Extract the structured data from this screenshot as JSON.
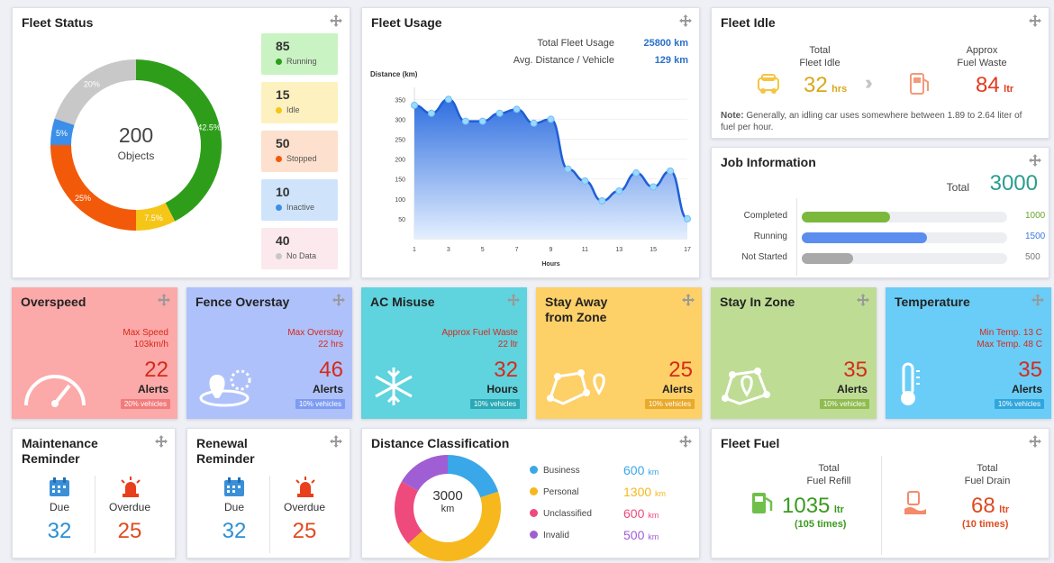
{
  "fleet_status": {
    "title": "Fleet Status",
    "total": "200",
    "total_label": "Objects",
    "segments": [
      {
        "label": "Running",
        "count": "85",
        "percent": 42.5,
        "percent_label": "42.5%",
        "color": "#2e9e1a"
      },
      {
        "label": "Idle",
        "count": "15",
        "percent": 7.5,
        "percent_label": "7.5%",
        "color": "#f5c518"
      },
      {
        "label": "Stopped",
        "count": "50",
        "percent": 25,
        "percent_label": "25%",
        "color": "#f25a0a"
      },
      {
        "label": "Inactive",
        "count": "10",
        "percent": 5,
        "percent_label": "5%",
        "color": "#3b8fe8"
      },
      {
        "label": "No Data",
        "count": "40",
        "percent": 20,
        "percent_label": "20%",
        "color": "#c8c8c8"
      }
    ],
    "box_colors": [
      "#c9f3c2",
      "#fdf1bf",
      "#fde0cd",
      "#cfe4fb",
      "#fbe9ee"
    ]
  },
  "fleet_usage": {
    "title": "Fleet Usage",
    "total_label": "Total Fleet Usage",
    "total_value": "25800 km",
    "avg_label": "Avg. Distance / Vehicle",
    "avg_value": "129 km",
    "chart_data": {
      "type": "area",
      "ylabel": "Distance (km)",
      "xlabel": "Hours",
      "x": [
        1,
        2,
        3,
        4,
        5,
        6,
        7,
        8,
        9,
        10,
        11,
        12,
        13,
        14,
        15,
        16,
        17
      ],
      "y": [
        335,
        315,
        350,
        295,
        295,
        315,
        325,
        290,
        300,
        175,
        145,
        95,
        120,
        165,
        130,
        170,
        50
      ],
      "ylim": [
        0,
        380
      ],
      "yticks": [
        "350",
        "300",
        "250",
        "200",
        "150",
        "100",
        "50"
      ],
      "xticks": [
        "1",
        "3",
        "5",
        "7",
        "9",
        "11",
        "13",
        "15",
        "17"
      ]
    }
  },
  "fleet_idle": {
    "title": "Fleet Idle",
    "idle_label_1": "Total",
    "idle_label_2": "Fleet Idle",
    "idle_value": "32",
    "idle_unit": "hrs",
    "waste_label_1": "Approx",
    "waste_label_2": "Fuel Waste",
    "waste_value": "84",
    "waste_unit": "ltr",
    "note_bold": "Note:",
    "note": "Generally, an idling car uses somewhere between 1.89 to 2.64 liter of fuel per hour."
  },
  "job_info": {
    "title": "Job Information",
    "total_label": "Total",
    "total_value": "3000",
    "rows": [
      {
        "label": "Completed",
        "value": "1000",
        "fraction": 0.43,
        "color": "#7cb83c",
        "text_color": "#6aa52a"
      },
      {
        "label": "Running",
        "value": "1500",
        "fraction": 0.61,
        "color": "#5b8def",
        "text_color": "#3a78e0"
      },
      {
        "label": "Not Started",
        "value": "500",
        "fraction": 0.25,
        "color": "#a9a9a9",
        "text_color": "#777777"
      }
    ]
  },
  "tiles": [
    {
      "title": "Overspeed",
      "meta1": "Max Speed",
      "meta2": "103km/h",
      "value": "22",
      "unit": "Alerts",
      "pct": "20% vehicles",
      "bg": "#fca9a9",
      "pct_bg": "#f27b7b",
      "icon": "speedometer-icon"
    },
    {
      "title": "Fence Overstay",
      "meta1": "Max Overstay",
      "meta2": "22 hrs",
      "value": "46",
      "unit": "Alerts",
      "pct": "10% vehicles",
      "bg": "#aec1fb",
      "pct_bg": "#7e9cf2",
      "icon": "geofence-icon"
    },
    {
      "title": "AC Misuse",
      "meta1": "Approx Fuel Waste",
      "meta2": "22 ltr",
      "value": "32",
      "unit": "Hours",
      "pct": "10% vehicles",
      "bg": "#5fd3de",
      "pct_bg": "#2aa9b5",
      "icon": "snowflake-icon"
    },
    {
      "title": "Stay Away from Zone",
      "meta1": "",
      "meta2": "",
      "value": "25",
      "unit": "Alerts",
      "pct": "10% vehicles",
      "bg": "#fdd068",
      "pct_bg": "#e9a92a",
      "icon": "zone-away-icon"
    },
    {
      "title": "Stay In Zone",
      "meta1": "",
      "meta2": "",
      "value": "35",
      "unit": "Alerts",
      "pct": "10% vehicles",
      "bg": "#bfdc94",
      "pct_bg": "#8fbb4f",
      "icon": "zone-in-icon"
    },
    {
      "title": "Temperature",
      "meta1": "Min Temp. 13 C",
      "meta2": "Max Temp. 48 C",
      "value": "35",
      "unit": "Alerts",
      "pct": "10% vehicles",
      "bg": "#69cdf7",
      "pct_bg": "#2fa6dc",
      "icon": "thermometer-icon"
    }
  ],
  "maintenance": {
    "title1": "Maintenance",
    "title2": "Reminder",
    "due_label": "Due",
    "due_value": "32",
    "overdue_label": "Overdue",
    "overdue_value": "25"
  },
  "renewal": {
    "title1": "Renewal",
    "title2": "Reminder",
    "due_label": "Due",
    "due_value": "32",
    "overdue_label": "Overdue",
    "overdue_value": "25"
  },
  "distance_class": {
    "title": "Distance Classification",
    "center_value": "3000",
    "center_unit": "km",
    "chart_data": {
      "type": "pie",
      "categories": [
        "Business",
        "Personal",
        "Unclassified",
        "Invalid"
      ],
      "values": [
        600,
        1300,
        600,
        500
      ],
      "value_labels": [
        "600",
        "1300",
        "600",
        "500"
      ],
      "unit": "km",
      "colors": [
        "#3aa7e8",
        "#f6b81c",
        "#ef4a7c",
        "#a05ed4"
      ]
    }
  },
  "fleet_fuel": {
    "title": "Fleet Fuel",
    "refill_label_1": "Total",
    "refill_label_2": "Fuel Refill",
    "refill_value": "1035",
    "refill_unit": "ltr",
    "refill_times": "(105 times)",
    "drain_label_1": "Total",
    "drain_label_2": "Fuel Drain",
    "drain_value": "68",
    "drain_unit": "ltr",
    "drain_times": "(10 times)"
  }
}
